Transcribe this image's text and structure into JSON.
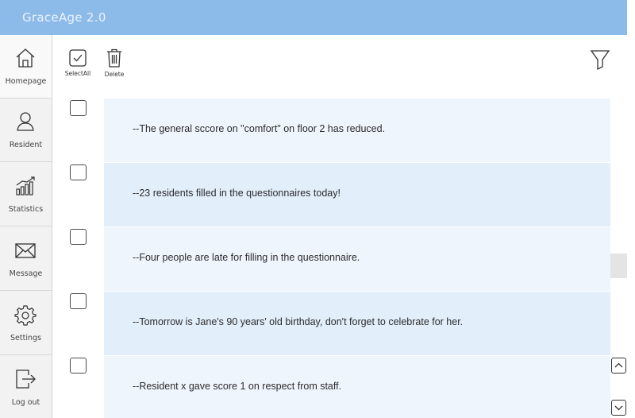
{
  "app": {
    "title": "GraceAge 2.0"
  },
  "sidebar": {
    "items": [
      {
        "label": "Homepage",
        "icon": "home-icon"
      },
      {
        "label": "Resident",
        "icon": "person-icon"
      },
      {
        "label": "Statistics",
        "icon": "bar-chart-icon"
      },
      {
        "label": "Message",
        "icon": "envelope-icon"
      },
      {
        "label": "Settings",
        "icon": "gear-icon"
      },
      {
        "label": "Log out",
        "icon": "logout-icon"
      }
    ],
    "active_index": 0
  },
  "toolbar": {
    "select_all_label": "SelectAll",
    "delete_label": "Delete",
    "filter_icon": "filter-icon"
  },
  "messages": [
    {
      "text": "--The general sccore on \"comfort\" on floor 2 has reduced."
    },
    {
      "text": "--23 residents filled in the questionnaires today!"
    },
    {
      "text": "--Four people are late for filling in the questionnaire."
    },
    {
      "text": "--Tomorrow is Jane's 90 years' old birthday, don't forget to celebrate for her."
    },
    {
      "text": "--Resident x gave score 1 on respect from staff."
    }
  ],
  "colors": {
    "titlebar": "#8dbbe9",
    "row_light": "#eef5fd",
    "row_dark": "#e2eefa",
    "sidebar_bg": "#f2f2f2"
  }
}
